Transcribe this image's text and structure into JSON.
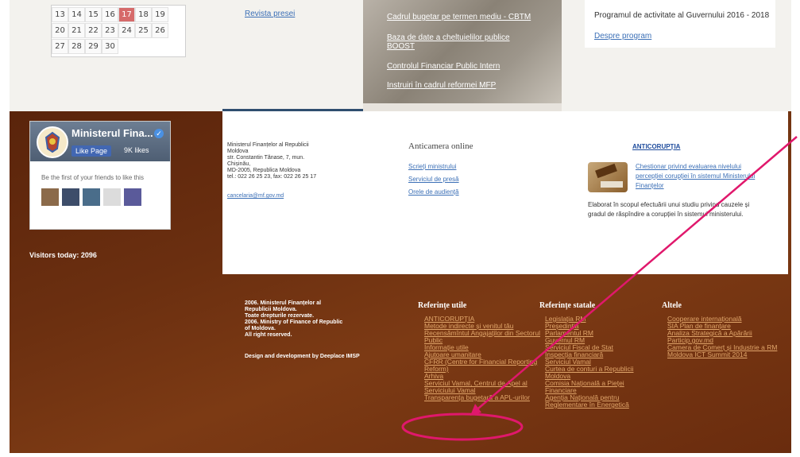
{
  "calendar": {
    "rows": [
      [
        "13",
        "14",
        "15",
        "16",
        "17",
        "18",
        "19"
      ],
      [
        "20",
        "21",
        "22",
        "23",
        "24",
        "25",
        "26"
      ],
      [
        "27",
        "28",
        "29",
        "30",
        "",
        "",
        ""
      ]
    ],
    "today": "17"
  },
  "top": {
    "revista": "Revista presei",
    "image_links": [
      "Cadrul bugetar pe termen mediu - CBTM",
      "Baza de date a cheltuielilor publice BOOST",
      "Controlul Financiar Public Intern",
      "Instruiri în cadrul reformei MFP"
    ],
    "program_text": "Programul de activitate al Guvernului 2016 - 2018",
    "program_link": "Despre program"
  },
  "facebook": {
    "page_name": "Ministerul Fina...",
    "like_label": "Like Page",
    "likes": "9K likes",
    "first_text": "Be the first of your friends to like this"
  },
  "visitors": "Visitors today: 2096",
  "contact": {
    "address_lines": [
      "Ministerul Finanțelor al Republicii",
      "Moldova",
      "str. Constantin Tănase, 7, mun.",
      "Chișinău,",
      "MD-2005, Republica Moldova",
      "tel.: 022 26 25 23, fax: 022 26 25 17"
    ],
    "email": "cancelaria@mf.gov.md"
  },
  "anticamera": {
    "title": "Anticamera online",
    "links": [
      "Scrieți ministrului",
      "Serviciul de presă",
      "Orele de audiență"
    ]
  },
  "anticoruptia": {
    "title": "ANTICORUPȚIA",
    "questionnaire": "Chestionar privind evaluarea nivelului percepției corupției în sistemul Ministerului Finanțelor",
    "description": "Elaborat în scopul efectuării unui studiu privind cauzele și gradul de răspîndire a corupției în sistemul ministerului."
  },
  "footer": {
    "copyright_lines": [
      "2006. Ministerul Finanțelor al",
      "Republicii Moldova.",
      "Toate drepturile rezervate.",
      "2006. Ministry of Finance of Republic",
      "of Moldova.",
      "All right reserved."
    ],
    "design_text": "Design and development by Deeplace IMSP",
    "col1_title": "Referințe utile",
    "col1_links": [
      "ANTICORUPȚIA",
      "Metode indirecte și venitul tău",
      "Recensămîntul Angajaților din Sectorul Public",
      "Informație utile",
      "Ajutoare umanitare",
      "CFRR (Centre for Financial Reporting Reform)",
      "Arhiva",
      "Serviciul Vamal, Centrul de Apel al Serviciului Vamal",
      "Transparența bugetară a APL-urilor"
    ],
    "col2_title": "Referințe statale",
    "col2_links": [
      "Legislația RM",
      "Președinția",
      "Parlamentul RM",
      "Guvernul RM",
      "Serviciul Fiscal de Stat",
      "Inspecția financiară",
      "Serviciul Vamal",
      "Curtea de conturi a Republicii Moldova",
      "Comisia Națională a Pieței Financiare",
      "Agenția Națională pentru Reglementare în Energetică"
    ],
    "col3_title": "Altele",
    "col3_links": [
      "Cooperare internațională",
      "SIA Plan de finanțare",
      "Analiza Strategică a Apărării",
      "Particip.gov.md",
      "Camera de Comerț și Industrie a RM",
      "Moldova ICT Summit 2014"
    ]
  },
  "annotation_colors": {
    "arrow": "#e0186c",
    "ellipse": "#e0186c"
  }
}
